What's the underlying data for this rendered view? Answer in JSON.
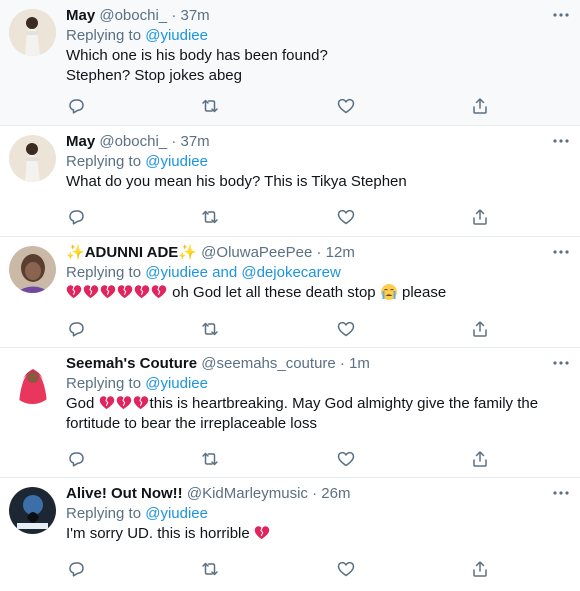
{
  "tweets": [
    {
      "name": "May",
      "handle": "@obochi_",
      "time": "37m",
      "replying_label": "Replying to",
      "mentions": "@yiudiee",
      "lines": [
        "Which one is his body has been found?",
        "Stephen? Stop jokes abeg"
      ]
    },
    {
      "name": "May",
      "handle": "@obochi_",
      "time": "37m",
      "replying_label": "Replying to",
      "mentions": "@yiudiee",
      "lines": [
        "What do you mean his body? This is Tikya Stephen"
      ]
    },
    {
      "name": "ADUNNI ADE",
      "name_sparkle": "✨",
      "handle": "@OluwaPeePee",
      "time": "12m",
      "replying_label": "Replying to",
      "mention1": "@yiudiee",
      "and_label": "and",
      "mention2": "@dejokecarew",
      "text_after_emojis": "oh God let all these death stop",
      "text_end": "please"
    },
    {
      "name": "Seemah's Couture",
      "handle": "@seemahs_couture",
      "time": "1m",
      "replying_label": "Replying to",
      "mentions": "@yiudiee",
      "text_start": "God",
      "text_rest": "this is heartbreaking. May God almighty give the family the",
      "line2": "fortitude to bear the irreplaceable loss"
    },
    {
      "name": "Alive! Out Now!!",
      "handle": "@KidMarleymusic",
      "time": "26m",
      "replying_label": "Replying to",
      "mentions": "@yiudiee",
      "text": "I'm sorry UD. this is horrible"
    }
  ],
  "separator": "·",
  "icons": [
    "reply-icon",
    "retweet-icon",
    "like-icon",
    "share-icon",
    "more-icon",
    "broken-heart-emoji",
    "crying-face-emoji",
    "sparkles-emoji"
  ],
  "colors": {
    "mention": "#1b95e0",
    "muted": "#5b7083",
    "icon": "#5b7083",
    "broken_heart": "#e0245e"
  }
}
